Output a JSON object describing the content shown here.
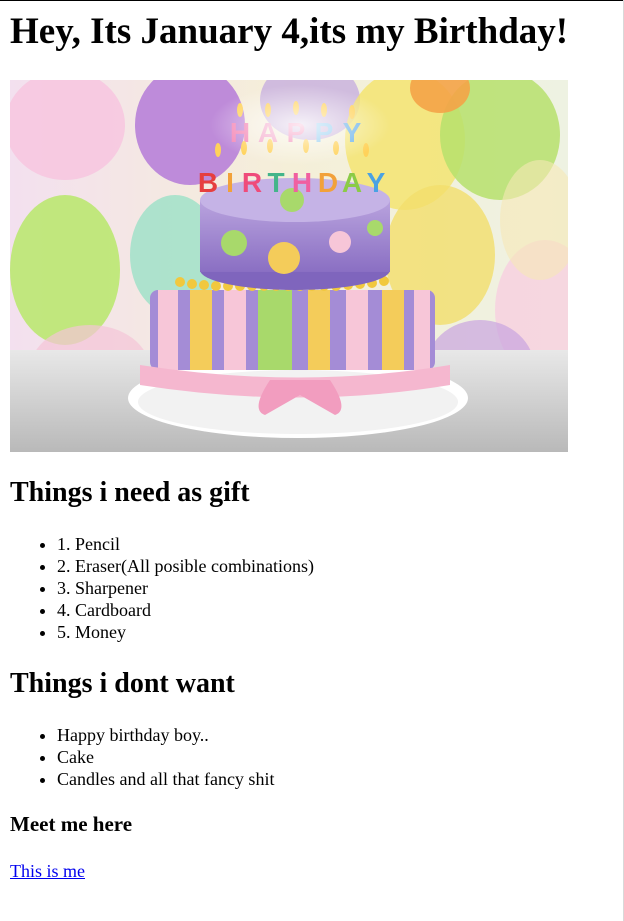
{
  "page": {
    "heading": "Hey, Its January 4,its my Birthday!",
    "gifts_heading": "Things i need as gift",
    "gifts": [
      "1. Pencil",
      "2. Eraser(All posible combinations)",
      "3. Sharpener",
      "4. Cardboard",
      "5. Money"
    ],
    "dont_heading": "Things i dont want",
    "dont_want": [
      "Happy birthday boy..",
      "Cake",
      "Candles and all that fancy shit"
    ],
    "meet_heading": "Meet me here",
    "link_text": "This is me",
    "image": {
      "candle_text": "HAPPY BIRTHDAY",
      "candle_letters_top": [
        "H",
        "A",
        "P",
        "P",
        "Y"
      ],
      "candle_letters_bottom": [
        "B",
        "I",
        "R",
        "T",
        "H",
        "D",
        "A",
        "Y"
      ]
    }
  }
}
